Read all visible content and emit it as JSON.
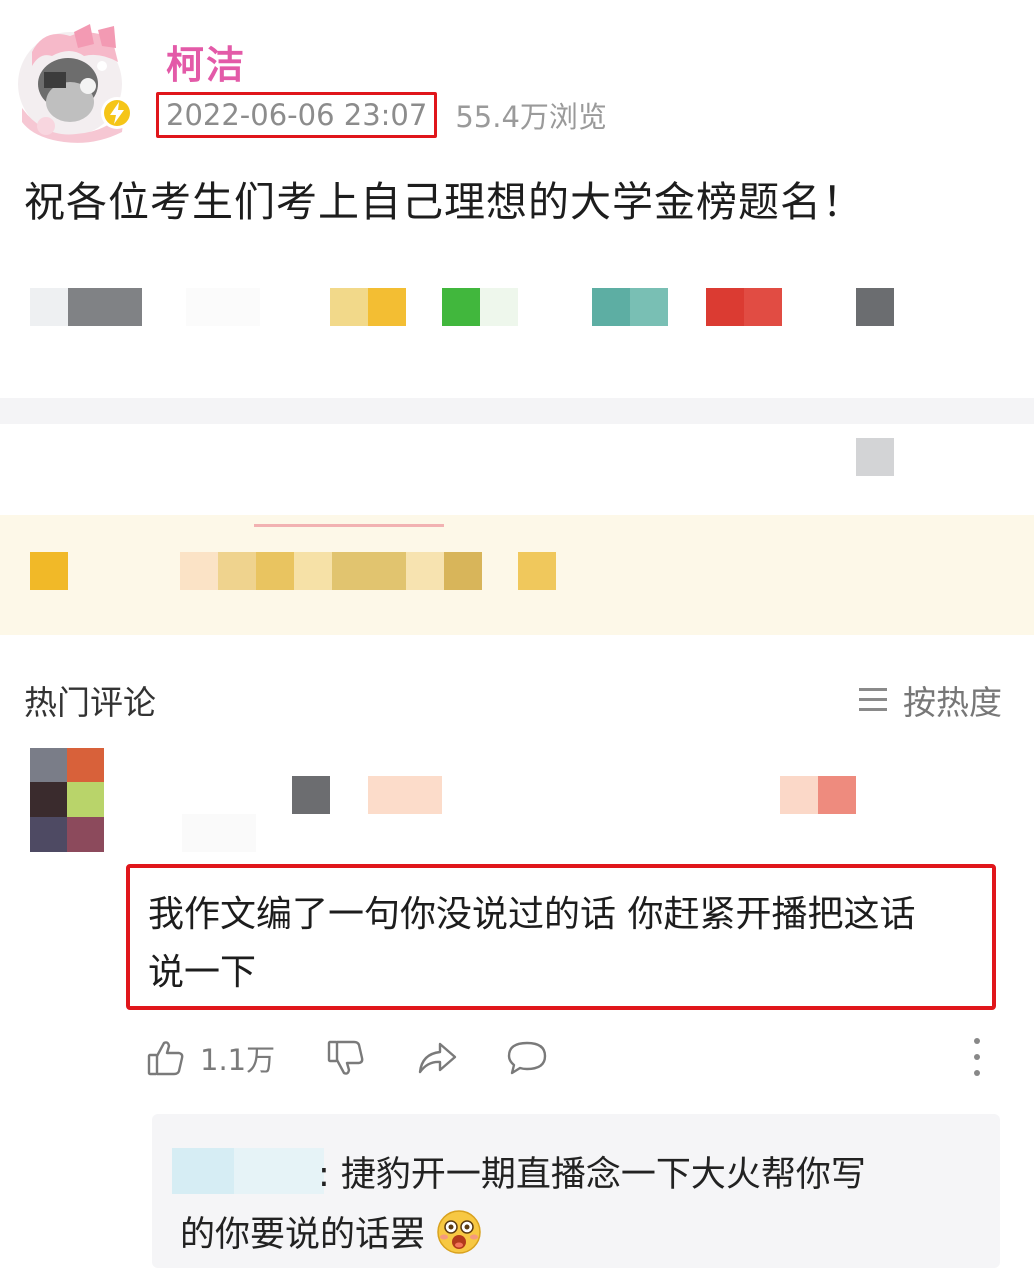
{
  "post": {
    "author": "柯洁",
    "time": "2022-06-06 23:07",
    "views": "55.4万浏览",
    "body": "祝各位考生们考上自己理想的大学金榜题名！"
  },
  "comments": {
    "title": "热门评论",
    "sort_label": "按热度",
    "top_comment": {
      "text_line1": "我作文编了一句你没说过的话 你赶紧开播把这话",
      "text_line2": "说一下",
      "like_count": "1.1万"
    },
    "reply": {
      "line1": ": 捷豹开一期直播念一下大火帮你写",
      "line2": "的你要说的话罢"
    }
  },
  "icons": {
    "avatar": "anime-avatar",
    "verified": "lightning-badge-icon",
    "sort": "menu-lines-icon",
    "like": "thumbs-up-icon",
    "dislike": "thumbs-down-icon",
    "share": "share-arrow-icon",
    "comment": "comment-bubble-icon",
    "more": "more-vertical-icon",
    "emoji": "laughing-emoji-icon"
  },
  "colors": {
    "author": "#e35aa8",
    "highlight_border": "#e0161b",
    "verified_badge": "#f5c518"
  }
}
